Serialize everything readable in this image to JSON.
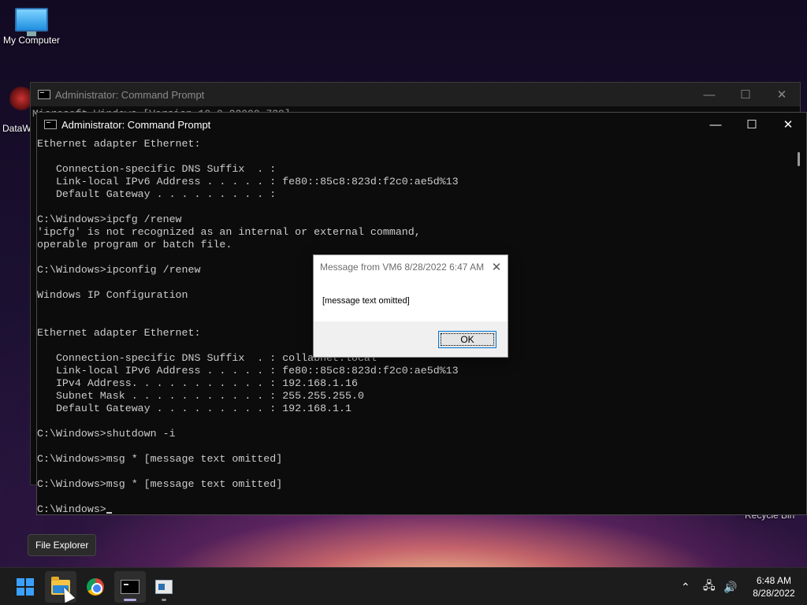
{
  "desktop": {
    "icons": [
      {
        "label": "My Computer"
      },
      {
        "label": "DataW"
      }
    ],
    "recycle_bin_label": "Recycle Bin"
  },
  "back_window": {
    "title": "Administrator: Command Prompt",
    "peek_text": "Microsoft Windows [Version 10.0.22000.739]"
  },
  "front_window": {
    "title": "Administrator: Command Prompt",
    "console_lines": [
      "Ethernet adapter Ethernet:",
      "",
      "   Connection-specific DNS Suffix  . :",
      "   Link-local IPv6 Address . . . . . : fe80::85c8:823d:f2c0:ae5d%13",
      "   Default Gateway . . . . . . . . . :",
      "",
      "C:\\Windows>ipcfg /renew",
      "'ipcfg' is not recognized as an internal or external command,",
      "operable program or batch file.",
      "",
      "C:\\Windows>ipconfig /renew",
      "",
      "Windows IP Configuration",
      "",
      "",
      "Ethernet adapter Ethernet:",
      "",
      "   Connection-specific DNS Suffix  . : collabnet.local",
      "   Link-local IPv6 Address . . . . . : fe80::85c8:823d:f2c0:ae5d%13",
      "   IPv4 Address. . . . . . . . . . . : 192.168.1.16",
      "   Subnet Mask . . . . . . . . . . . : 255.255.255.0",
      "   Default Gateway . . . . . . . . . : 192.168.1.1",
      "",
      "C:\\Windows>shutdown -i",
      "",
      "C:\\Windows>msg * [message text omitted]",
      "",
      "C:\\Windows>msg * [message text omitted]",
      ""
    ],
    "prompt": "C:\\Windows>"
  },
  "dialog": {
    "title": "Message from VM6 8/28/2022 6:47 AM",
    "message": "[message text omitted]",
    "ok_label": "OK"
  },
  "tooltip": {
    "text": "File Explorer"
  },
  "taskbar": {
    "apps": [
      {
        "icon": "windows-start-icon"
      },
      {
        "icon": "file-explorer-icon"
      },
      {
        "icon": "chrome-icon"
      },
      {
        "icon": "command-prompt-icon"
      },
      {
        "icon": "app-window-icon"
      }
    ],
    "clock": {
      "time": "6:48 AM",
      "date": "8/28/2022"
    }
  },
  "colors": {
    "console_bg": "#0c0c0c",
    "console_text": "#cccccc",
    "taskbar_bg": "#1c1c1c",
    "dialog_button_border": "#0078d7"
  }
}
